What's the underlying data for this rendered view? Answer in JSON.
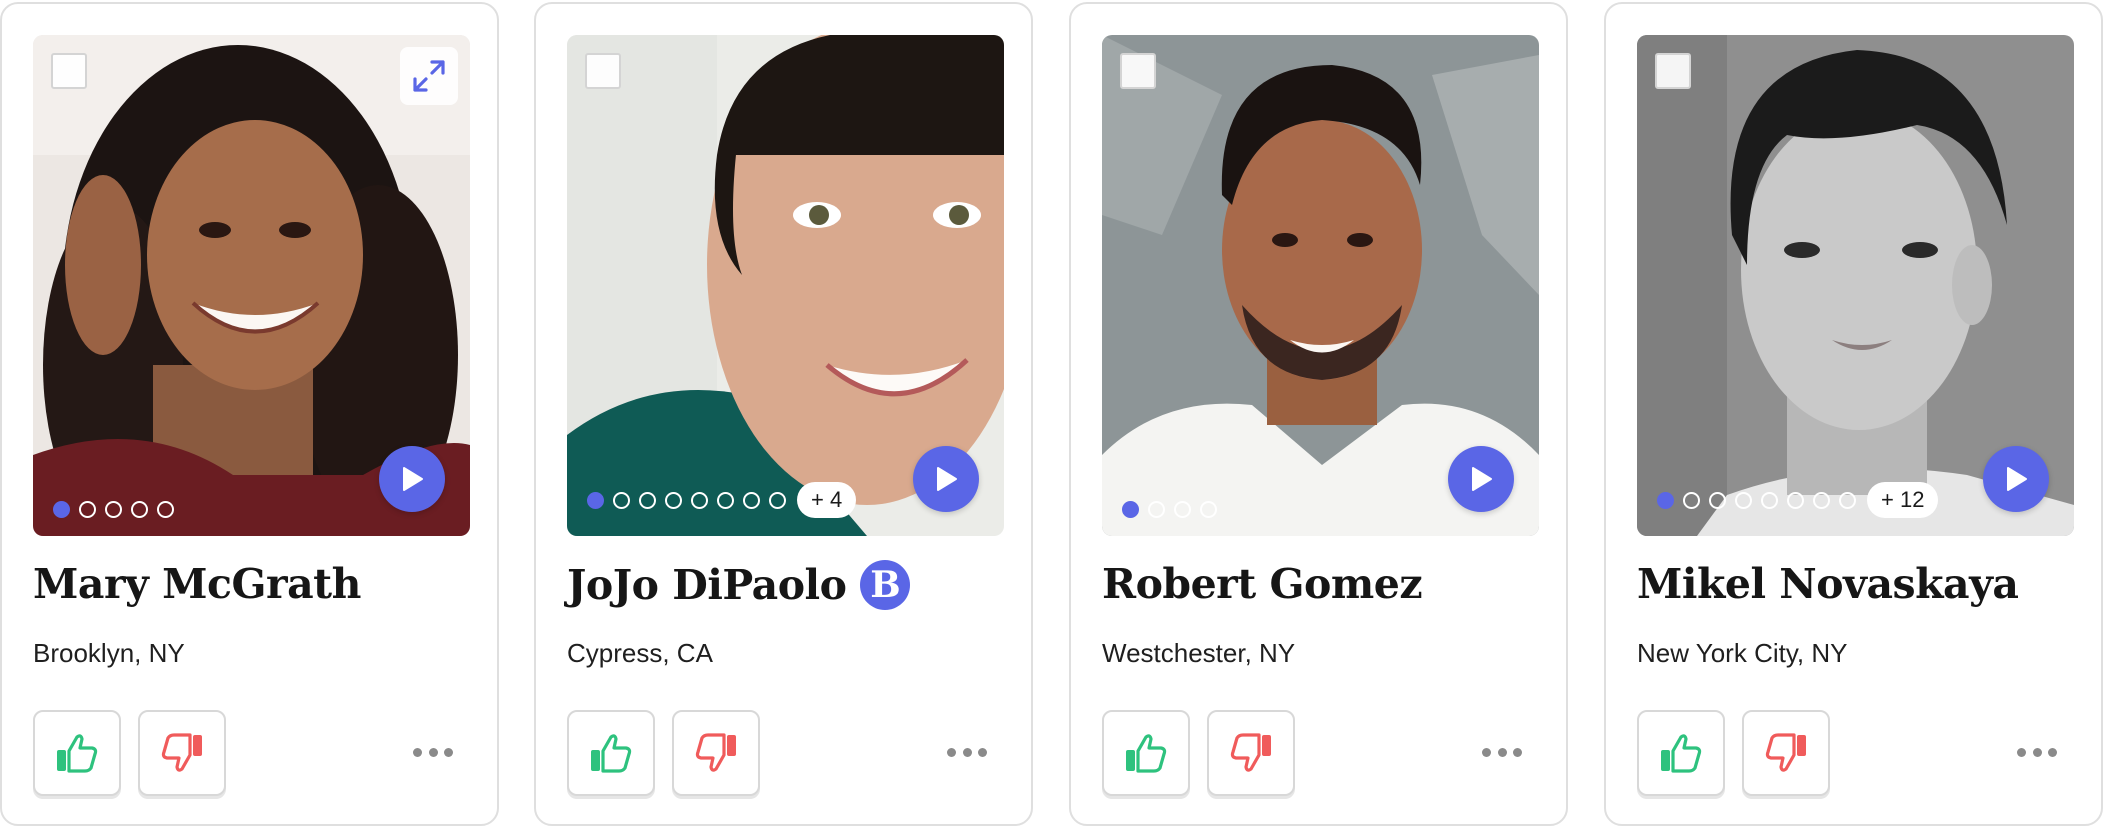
{
  "colors": {
    "accent": "#5a66e6",
    "thumbs_up": "#2ec27e",
    "thumbs_down": "#f05b5b",
    "dot_menu": "#8a8a8a"
  },
  "cards": [
    {
      "name": "Mary McGrath",
      "location": "Brooklyn, NY",
      "photo_count": 5,
      "active_photo": 1,
      "more_photos": "",
      "has_badge": false,
      "has_expand": true
    },
    {
      "name": "JoJo DiPaolo",
      "location": "Cypress, CA",
      "photo_count": 8,
      "active_photo": 1,
      "more_photos": "+ 4",
      "has_badge": true,
      "badge_letter": "B",
      "has_expand": false
    },
    {
      "name": "Robert Gomez",
      "location": "Westchester, NY",
      "photo_count": 4,
      "active_photo": 1,
      "more_photos": "",
      "has_badge": false,
      "has_expand": false
    },
    {
      "name": "Mikel Novaskaya",
      "location": "New York City, NY",
      "photo_count": 8,
      "active_photo": 1,
      "more_photos": "+ 12",
      "has_badge": false,
      "has_expand": false
    }
  ]
}
